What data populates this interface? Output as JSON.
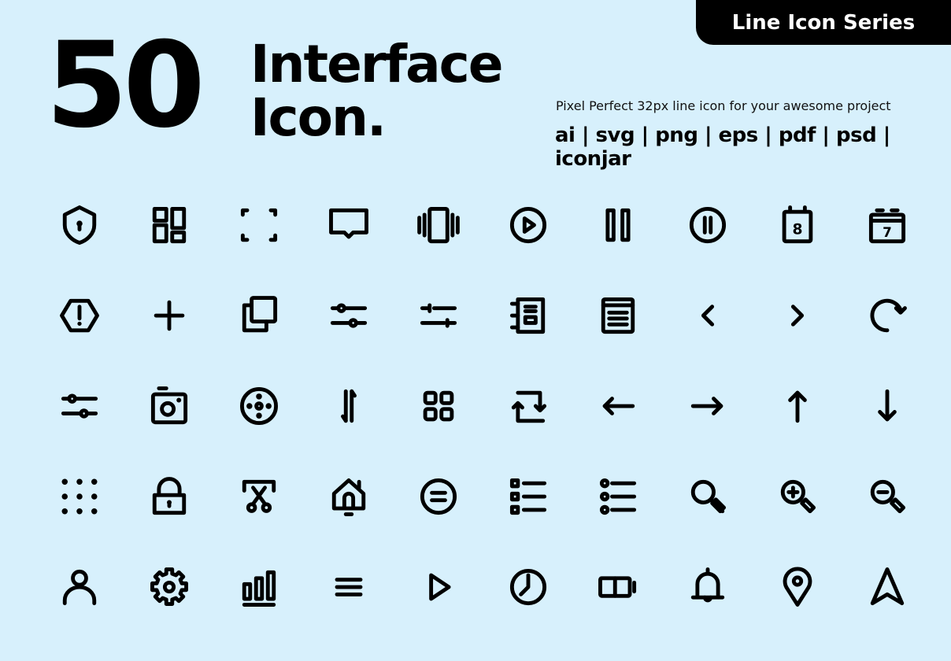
{
  "badge": {
    "label": "Line Icon Series"
  },
  "header": {
    "count": "50",
    "title_line1": "Interface",
    "title_line2": "Icon.",
    "subtitle": "Pixel Perfect 32px line icon for your awesome project",
    "formats": "ai | svg | png | eps | pdf | psd | iconjar"
  },
  "colors": {
    "background": "#d7f0fc",
    "ink": "#000000",
    "badge_text": "#ffffff"
  },
  "icons": [
    "shield-lock",
    "dashboard-layout",
    "fullscreen-frame",
    "chat-bubble",
    "vibrate-phone",
    "play-circle",
    "pause",
    "pause-circle",
    "calendar-8",
    "calendar-7",
    "warning-hexagon",
    "plus",
    "copy",
    "sliders-horizontal",
    "adjustments",
    "notebook",
    "document-list",
    "chevron-left",
    "chevron-right",
    "redo-rotate",
    "sliders",
    "camera",
    "film-reel",
    "swap-vertical",
    "grid-apps",
    "repeat",
    "arrow-left",
    "arrow-right",
    "arrow-up",
    "arrow-down",
    "dots-grid",
    "padlock",
    "cut-selection",
    "home-lock",
    "equals-circle",
    "checkbox-list",
    "bullet-list",
    "search",
    "zoom-in",
    "zoom-out",
    "user",
    "settings-gear",
    "bar-chart",
    "menu",
    "play",
    "clock",
    "battery-half",
    "bell",
    "map-pin",
    "navigation"
  ]
}
